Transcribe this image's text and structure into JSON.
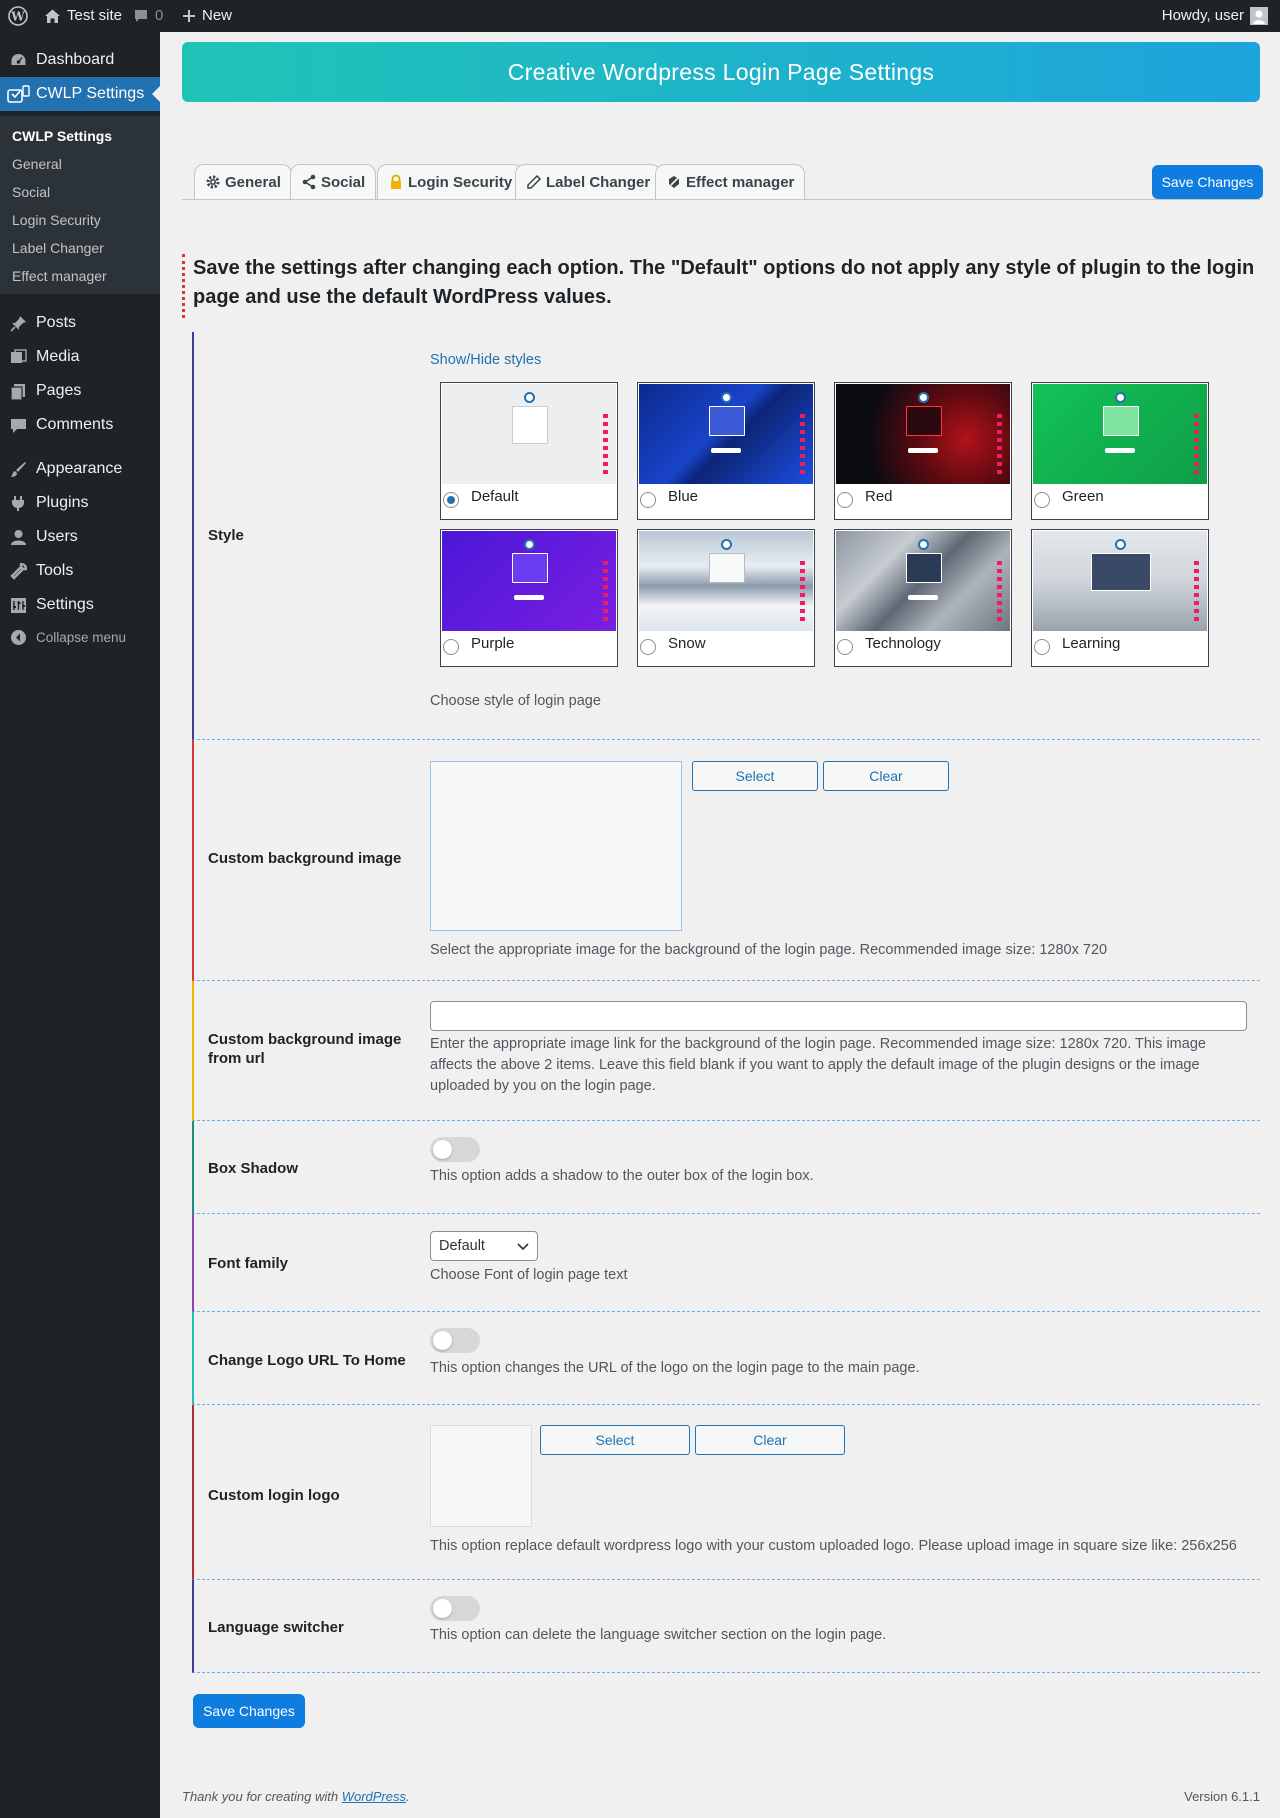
{
  "adminbar": {
    "site": "Test site",
    "comments": "0",
    "new": "New",
    "howdy": "Howdy, user"
  },
  "sidebar": {
    "items": [
      {
        "label": "Dashboard",
        "icon": "dashboard-icon"
      },
      {
        "label": "CWLP Settings",
        "icon": "cwlp-icon"
      },
      {
        "label": "Posts",
        "icon": "pin-icon"
      },
      {
        "label": "Media",
        "icon": "media-icon"
      },
      {
        "label": "Pages",
        "icon": "pages-icon"
      },
      {
        "label": "Comments",
        "icon": "comment-icon"
      },
      {
        "label": "Appearance",
        "icon": "brush-icon"
      },
      {
        "label": "Plugins",
        "icon": "plug-icon"
      },
      {
        "label": "Users",
        "icon": "user-icon"
      },
      {
        "label": "Tools",
        "icon": "wrench-icon"
      },
      {
        "label": "Settings",
        "icon": "settings-icon"
      },
      {
        "label": "Collapse menu",
        "icon": "collapse-icon"
      }
    ],
    "submenu": [
      "CWLP Settings",
      "General",
      "Social",
      "Login Security",
      "Label Changer",
      "Effect manager"
    ]
  },
  "banner": {
    "title": "Creative Wordpress Login Page Settings"
  },
  "tabs": [
    "General",
    "Social",
    "Login Security",
    "Label Changer",
    "Effect manager"
  ],
  "save_label": "Save Changes",
  "notice": "Save the settings after changing each option. The \"Default\" options do not apply any style of plugin to the login page and use the default WordPress values.",
  "style": {
    "label": "Style",
    "toggle_link": "Show/Hide styles",
    "options": [
      "Default",
      "Blue",
      "Red",
      "Green",
      "Purple",
      "Snow",
      "Technology",
      "Learning"
    ],
    "selected": "Default",
    "desc": "Choose style of login page"
  },
  "bg_image": {
    "label": "Custom background image",
    "select": "Select",
    "clear": "Clear",
    "desc": "Select the appropriate image for the background of the login page. Recommended image size: 1280x 720"
  },
  "bg_url": {
    "label": "Custom background image from url",
    "value": "",
    "desc": "Enter the appropriate image link for the background of the login page. Recommended image size: 1280x 720. This image affects the above 2 items. Leave this field blank if you want to apply the default image of the plugin designs or the image uploaded by you on the login page."
  },
  "box_shadow": {
    "label": "Box Shadow",
    "on": false,
    "desc": "This option adds a shadow to the outer box of the login box."
  },
  "font_family": {
    "label": "Font family",
    "value": "Default",
    "desc": "Choose Font of login page text"
  },
  "logo_url": {
    "label": "Change Logo URL To Home",
    "on": false,
    "desc": "This option changes the URL of the logo on the login page to the main page."
  },
  "login_logo": {
    "label": "Custom login logo",
    "select": "Select",
    "clear": "Clear",
    "desc": "This option replace default wordpress logo with your custom uploaded logo. Please upload image in square size like: 256x256"
  },
  "lang_switcher": {
    "label": "Language switcher",
    "on": false,
    "desc": "This option can delete the language switcher section on the login page."
  },
  "footer": {
    "thanks": "Thank you for creating with",
    "link": "WordPress",
    "version": "Version 6.1.1"
  },
  "colors": {
    "accent": "#2271b1",
    "button": "#0f7de0",
    "banner_start": "#20c4b6",
    "banner_end": "#1da4dc"
  }
}
